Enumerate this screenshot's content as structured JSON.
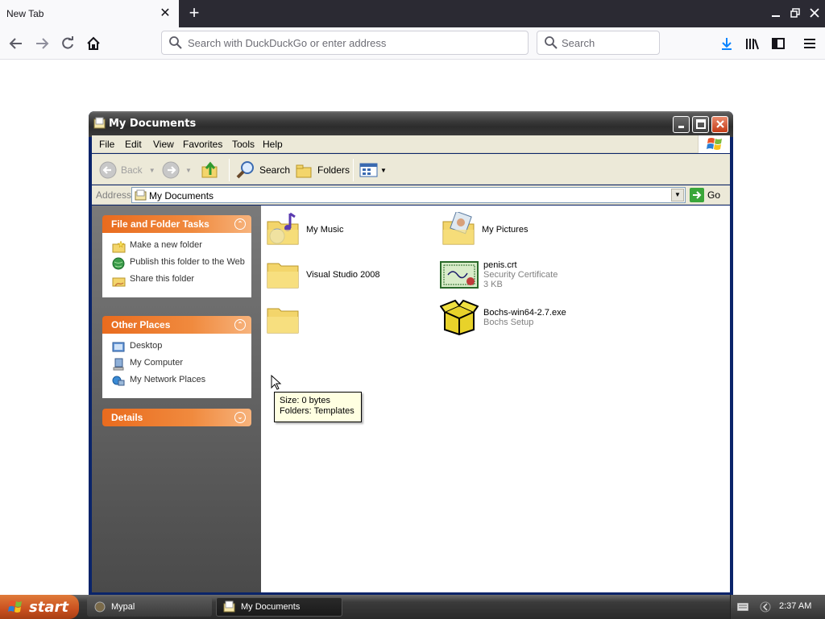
{
  "browser": {
    "tab_title": "New Tab",
    "tab_close": "✕",
    "new_tab": "+",
    "url_placeholder": "Search with DuckDuckGo or enter address",
    "search_placeholder": "Search"
  },
  "window": {
    "title": "My Documents",
    "menu": [
      "File",
      "Edit",
      "View",
      "Favorites",
      "Tools",
      "Help"
    ],
    "toolbar": {
      "back": "Back",
      "search": "Search",
      "folders": "Folders"
    },
    "address": {
      "label": "Address",
      "value": "My Documents",
      "go": "Go"
    }
  },
  "task_pane": {
    "file_folder_tasks": {
      "title": "File and Folder Tasks",
      "items": [
        "Make a new folder",
        "Publish this folder to the Web",
        "Share this folder"
      ]
    },
    "other_places": {
      "title": "Other Places",
      "items": [
        "Desktop",
        "My Computer",
        "My Network Places"
      ]
    },
    "details": {
      "title": "Details"
    }
  },
  "files": [
    {
      "name": "My Music",
      "icon": "music-folder-icon"
    },
    {
      "name": "My Pictures",
      "icon": "pictures-folder-icon"
    },
    {
      "name": "Visual Studio 2008",
      "icon": "folder-icon"
    },
    {
      "name": "penis.crt",
      "type": "Security Certificate",
      "size": "3 KB",
      "icon": "certificate-icon"
    },
    {
      "name": "Bochs-win64-2.7.exe",
      "type": "Bochs Setup",
      "icon": "installer-box-icon"
    }
  ],
  "tooltip": {
    "line1": "Size: 0 bytes",
    "line2": "Folders: Templates"
  },
  "taskbar": {
    "start": "start",
    "items": [
      "Mypal",
      "My Documents"
    ],
    "clock": "2:37 AM"
  },
  "colors": {
    "xp_orange": "#e96b1e",
    "title_gray": "#3a3a3a",
    "browser_dark": "#2b2a33"
  }
}
